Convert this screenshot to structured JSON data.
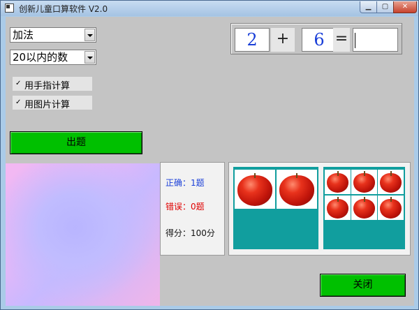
{
  "window": {
    "title": "创新儿童口算软件 V2.0"
  },
  "controls": {
    "operation_select": "加法",
    "range_select": "20以内的数",
    "finger_checkbox": {
      "label": "用手指计算",
      "checked": true,
      "mark": "☑"
    },
    "picture_checkbox": {
      "label": "用图片计算",
      "checked": true,
      "mark": "☑"
    },
    "question_button": "出题",
    "close_button": "关闭"
  },
  "equation": {
    "operand1": "2",
    "operator": "+",
    "operand2": "6",
    "equals": "=",
    "answer": ""
  },
  "score": {
    "correct": "正确：1题",
    "wrong": "错误：0题",
    "points": "得分：100分"
  },
  "pictures": {
    "left_group_apples": 2,
    "right_group_apples": 6
  },
  "colors": {
    "client_bg": "#c4c4c4",
    "button_green": "#00c000",
    "correct_text": "#1a3fd8",
    "wrong_text": "#e00000",
    "teal_panel": "#119e9e",
    "operand_text": "#1a3fd8"
  }
}
